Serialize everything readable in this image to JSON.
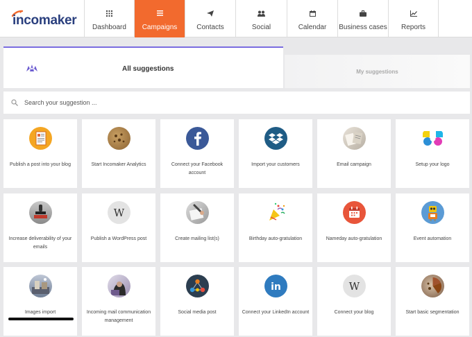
{
  "brand": {
    "name": "incomaker",
    "accent": "#f26a2e",
    "navy": "#2a3f7e"
  },
  "nav": [
    {
      "label": "Dashboard",
      "icon": "grid-icon",
      "active": false
    },
    {
      "label": "Campaigns",
      "icon": "list-icon",
      "active": true
    },
    {
      "label": "Contacts",
      "icon": "paper-plane-icon",
      "active": false
    },
    {
      "label": "Social",
      "icon": "users-icon",
      "active": false
    },
    {
      "label": "Calendar",
      "icon": "calendar-icon",
      "active": false
    },
    {
      "label": "Business cases",
      "icon": "briefcase-icon",
      "active": false
    },
    {
      "label": "Reports",
      "icon": "line-chart-icon",
      "active": false
    }
  ],
  "tabs": {
    "all": "All suggestions",
    "my": "My suggestions"
  },
  "search": {
    "placeholder": "Search your suggestion ..."
  },
  "cards": [
    {
      "label": "Publish a post into your blog",
      "icon": "blog-post-icon"
    },
    {
      "label": "Start Incomaker Analytics",
      "icon": "analytics-cookie-icon"
    },
    {
      "label": "Connect your Facebook account",
      "icon": "facebook-icon"
    },
    {
      "label": "Import your customers",
      "icon": "dropbox-icon"
    },
    {
      "label": "Email campaign",
      "icon": "email-photo-icon"
    },
    {
      "label": "Setup your logo",
      "icon": "logo-design-icon"
    },
    {
      "label": "Increase deliverability of your emails",
      "icon": "stamp-icon"
    },
    {
      "label": "Publish a WordPress post",
      "icon": "wordpress-icon"
    },
    {
      "label": "Create mailing list(s)",
      "icon": "mailing-list-icon"
    },
    {
      "label": "Birthday auto-gratulation",
      "icon": "party-popper-icon"
    },
    {
      "label": "Nameday auto-gratulation",
      "icon": "calendar-day-icon"
    },
    {
      "label": "Event automation",
      "icon": "robot-icon"
    },
    {
      "label": "Images import",
      "icon": "images-icon"
    },
    {
      "label": "Incoming mail communication management",
      "icon": "incoming-mail-icon"
    },
    {
      "label": "Social media post",
      "icon": "social-network-icon"
    },
    {
      "label": "Connect your LinkedIn account",
      "icon": "linkedin-icon"
    },
    {
      "label": "Connect your blog",
      "icon": "wikipedia-icon"
    },
    {
      "label": "Start basic segmentation",
      "icon": "segmentation-icon"
    }
  ]
}
